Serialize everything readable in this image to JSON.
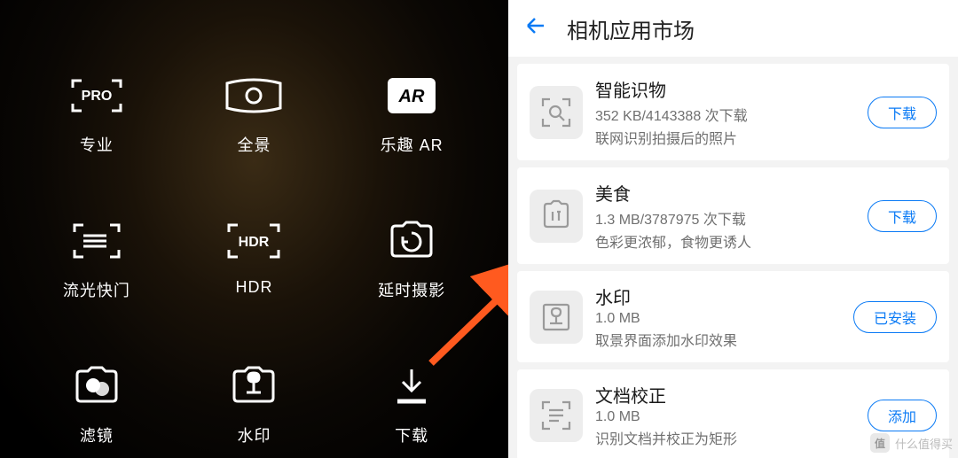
{
  "left": {
    "modes": [
      {
        "label": "专业",
        "icon": "pro-icon"
      },
      {
        "label": "全景",
        "icon": "panorama-icon"
      },
      {
        "label": "乐趣 AR",
        "icon": "ar-icon"
      },
      {
        "label": "流光快门",
        "icon": "light-painting-icon"
      },
      {
        "label": "HDR",
        "icon": "hdr-icon"
      },
      {
        "label": "延时摄影",
        "icon": "timelapse-icon"
      },
      {
        "label": "滤镜",
        "icon": "filter-icon"
      },
      {
        "label": "水印",
        "icon": "watermark-icon"
      },
      {
        "label": "下载",
        "icon": "download-icon"
      }
    ]
  },
  "right": {
    "title": "相机应用市场",
    "apps": [
      {
        "name": "智能识物",
        "meta": "352 KB/4143388 次下载",
        "desc": "联网识别拍摄后的照片",
        "button": "下载",
        "icon": "scan-icon"
      },
      {
        "name": "美食",
        "meta": "1.3 MB/3787975 次下载",
        "desc": "色彩更浓郁，食物更诱人",
        "button": "下载",
        "icon": "food-icon"
      },
      {
        "name": "水印",
        "meta": "1.0 MB",
        "desc": "取景界面添加水印效果",
        "button": "已安装",
        "icon": "stamp-icon"
      },
      {
        "name": "文档校正",
        "meta": "1.0 MB",
        "desc": "识别文档并校正为矩形",
        "button": "添加",
        "icon": "document-icon"
      }
    ]
  },
  "watermark": "什么值得买"
}
